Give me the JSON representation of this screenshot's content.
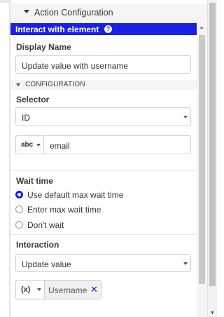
{
  "action_header": {
    "title": "Action Configuration"
  },
  "interact": {
    "title": "Interact with element",
    "help_glyph": "?"
  },
  "display_name": {
    "label": "Display Name",
    "value": "Update value with username"
  },
  "configuration": {
    "section_label": "CONFIGURATION"
  },
  "selector": {
    "label": "Selector",
    "type_value": "ID",
    "input_type": "abc",
    "input_value": "email"
  },
  "wait_time": {
    "label": "Wait time",
    "options": [
      {
        "label": "Use default max wait time",
        "selected": true
      },
      {
        "label": "Enter max wait time",
        "selected": false
      },
      {
        "label": "Don't wait",
        "selected": false
      }
    ]
  },
  "interaction": {
    "label": "Interaction",
    "value": "Update value",
    "variable_type": "(x)",
    "variable_name": "Username",
    "remove_glyph": "✕"
  },
  "colors": {
    "accent": "#1a1fe6",
    "header_bg": "#f5f5f5",
    "border": "#cfcfcf"
  }
}
